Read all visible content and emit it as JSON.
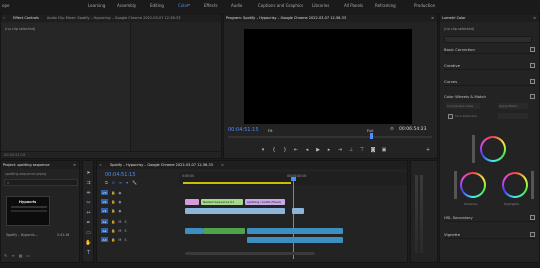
{
  "workspaces": [
    "Learning",
    "Assembly",
    "Editing",
    "Color",
    "Effects",
    "Audio",
    "Captions and Graphics",
    "Libraries",
    "All Panels",
    "Reframing",
    "Production"
  ],
  "active_workspace": "Color",
  "workspace_fragment": "ope",
  "source_panel": {
    "tabs": [
      "Effect Controls",
      "Audio Clip Mixer: Spotify – Hypocrisy – Google Chrome 2022-03-07 12-56-33"
    ],
    "no_clip": "(no clip selected)",
    "timecode": "00:04:51:15"
  },
  "program_monitor": {
    "title": "Program: Spotify – Hypocrisy – Google Chrome 2022-03-07 12-56-33",
    "timecode": "00:04:51:15",
    "fit": "Fit",
    "quality": "Full",
    "duration": "00:06:54:23"
  },
  "project_panel": {
    "title": "Project: spotting sequence",
    "search_placeholder": "spotting sequence.prproj",
    "thumb_label": "Spotify – Hypocris...",
    "thumb_duration": "2:41:16",
    "thumb_title": "Hypocris"
  },
  "timeline": {
    "tab": "Spotify – Hypocrisy – Google Chrome 2022-03-07 12-56-33",
    "timecode": "00:04:51:15",
    "ruler": [
      "0:00:00",
      "00:05:00:00"
    ],
    "video_tracks": [
      "V3",
      "V2",
      "V1"
    ],
    "audio_tracks": [
      "A1",
      "A2",
      "A3"
    ],
    "clip_labels": [
      "Nested Sequence 01",
      "spotting credits (fixed)"
    ]
  },
  "lumetri": {
    "title": "Lumetri Color",
    "clip": "(no clip selected)",
    "sections": [
      "Basic Correction",
      "Creative",
      "Curves",
      "Color Wheels & Match",
      "HSL Secondary",
      "Vignette"
    ],
    "compare_view": "Comparison View",
    "apply_match": "Apply Match",
    "face_detection": "Face Detection",
    "shadows": "Shadows",
    "highlights": "Highlights"
  }
}
